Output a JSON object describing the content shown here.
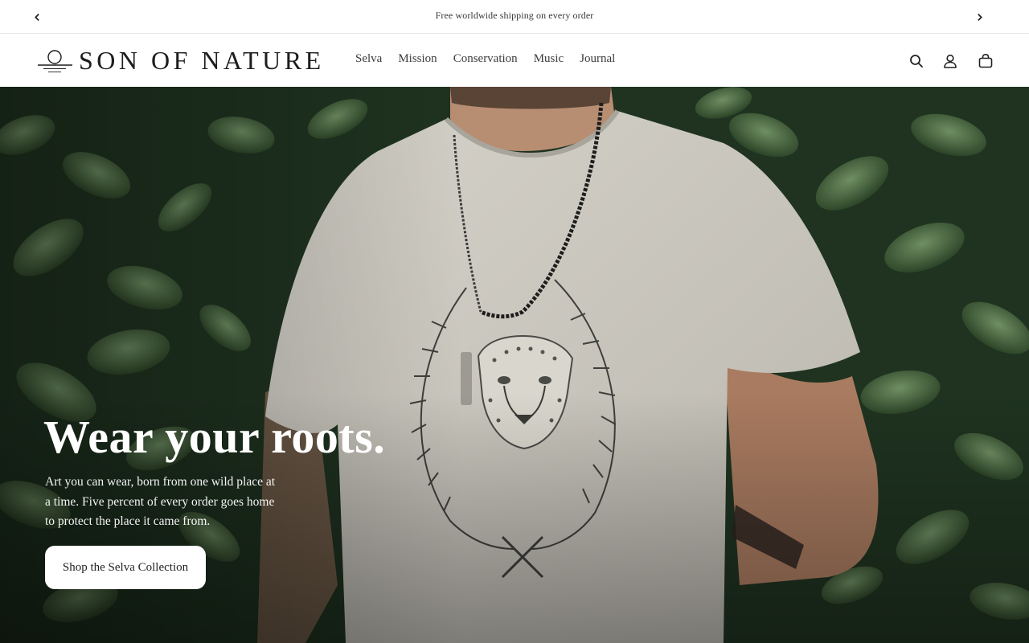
{
  "announcement": {
    "text": "Free worldwide shipping on every order",
    "prev_icon": "chevron-left-icon",
    "next_icon": "chevron-right-icon"
  },
  "header": {
    "logo_text": "SON OF NATURE",
    "nav": [
      "Selva",
      "Mission",
      "Conservation",
      "Music",
      "Journal"
    ],
    "icons": [
      "search-icon",
      "account-icon",
      "cart-icon"
    ]
  },
  "hero": {
    "title": "Wear your roots.",
    "copy": "Art you can wear, born from one wild place at a time. Five percent of every order goes home to protect the place it came from.",
    "cta_label": "Shop the Selva Collection"
  },
  "colors": {
    "text": "#222222",
    "foliage": "#2f4a2c",
    "shirt": "#c9c6bd",
    "button_bg": "#ffffff"
  }
}
